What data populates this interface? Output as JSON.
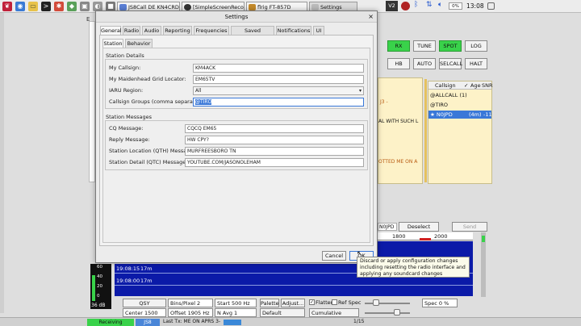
{
  "taskbar": {
    "apps": [
      {
        "label": "JS8Call DE KN4CRD..."
      },
      {
        "label": "[SimpleScreenRecord..."
      },
      {
        "label": "flrig FT-857D"
      },
      {
        "label": "Settings"
      }
    ],
    "tray": {
      "vnc": "V2",
      "volume": "0%",
      "time": "13:08"
    }
  },
  "main": {
    "buttons_row1": [
      "RX",
      "TUNE",
      "SPOT",
      "LOG"
    ],
    "buttons_row2": [
      "HB",
      "AUTO",
      "SELCALL",
      "HALT"
    ],
    "text_snippets": [
      "J3 -",
      "AL WITH SUCH L",
      "OTTED ME ON A"
    ],
    "callsign_table": {
      "headers": [
        "Callsign",
        "Age",
        "SNR"
      ],
      "rows": [
        {
          "callsign": "@ALLCALL (1)",
          "age": "",
          "snr": ""
        },
        {
          "callsign": "@TIRO",
          "age": "",
          "snr": ""
        },
        {
          "callsign": "★ N0JPD",
          "age": "(4m)",
          "snr": "-11"
        }
      ]
    },
    "selected_call": "N0JPD",
    "deselect_label": "Deselect",
    "send_label": "Send",
    "freq_ticks": [
      "1800",
      "2000"
    ],
    "wf_lines": [
      {
        "time": "19:08:15",
        "band": "17m"
      },
      {
        "time": "19:08:00",
        "band": "17m"
      }
    ],
    "db_label": "36 dB",
    "db_scale": [
      "60",
      "40",
      "20",
      "0"
    ],
    "controls": {
      "qsy": "QSY",
      "center": "Center 1500 Hz",
      "bins": "Bins/Pixel  2",
      "offset": "Offset 1905 Hz",
      "start": "Start 500 Hz",
      "navg": "N Avg  1",
      "palette": "Palette",
      "adjust": "Adjust...",
      "default": "Default",
      "flatten": "Flatten",
      "refspec": "Ref Spec",
      "cumulative": "Cumulative",
      "spec": "Spec 0 %"
    },
    "statusbar": {
      "receiving": "Receiving",
      "mode": "JS8",
      "last_tx": "Last Tx: ME ON APRS 3-",
      "page": "1/15"
    }
  },
  "dialog": {
    "title": "Settings",
    "tabs": [
      "General",
      "Radio",
      "Audio",
      "Reporting",
      "Frequencies",
      "Saved Messages",
      "Notifications",
      "UI"
    ],
    "subtabs": [
      "Station",
      "Behavior"
    ],
    "station_details_title": "Station Details",
    "fields": [
      {
        "label": "My Callsign:",
        "value": "KM4ACK"
      },
      {
        "label": "My Maidenhead Grid Locator:",
        "value": "EM65TV"
      },
      {
        "label": "IARU Region:",
        "value": "All"
      },
      {
        "label": "Callsign Groups (comma separated):",
        "value": "@TIRO"
      }
    ],
    "station_messages_title": "Station Messages",
    "messages": [
      {
        "label": "CQ Message:",
        "value": "CQCQ EM65"
      },
      {
        "label": "Reply Message:",
        "value": "HW CPY?"
      },
      {
        "label": "Station Location (QTH) Message:",
        "value": "MURFREESBORO TN"
      },
      {
        "label": "Station Detail (QTC) Message:",
        "value": "YOUTUBE.COM/JASONOLEHAM"
      }
    ],
    "cancel_label": "Cancel",
    "ok_label": "OK",
    "tooltip": "Discard or apply configuration changes including resetting the radio interface and applying any soundcard changes"
  },
  "colors": {
    "accent_green": "#39d24a",
    "waterfall": "#0b1aa8",
    "selection": "#3a78d8"
  }
}
